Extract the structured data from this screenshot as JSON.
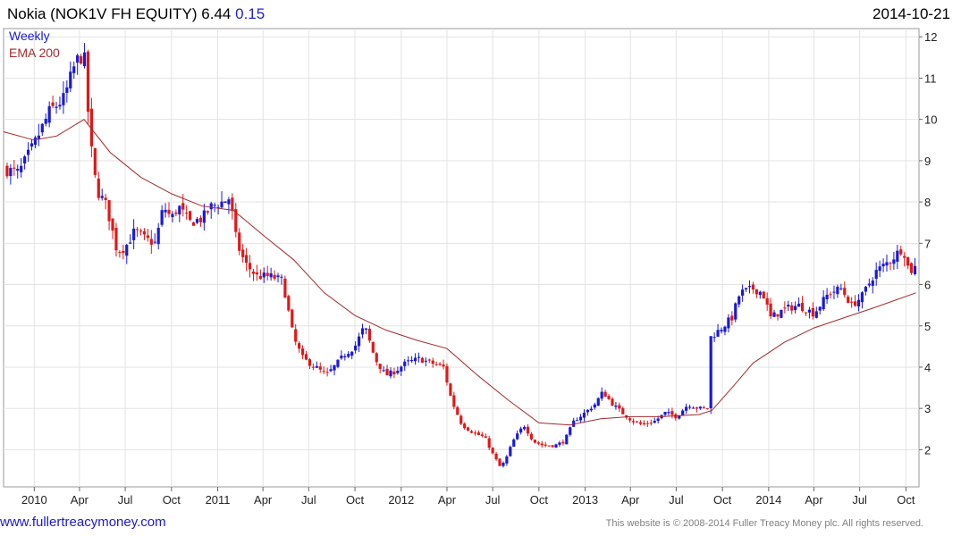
{
  "header": {
    "title": "Nokia (NOK1V FH EQUITY)",
    "price": "6.44",
    "change": "0.15",
    "date": "2014-10-21"
  },
  "footer": {
    "website": "www.fullertreacymoney.com",
    "copyright": "This website is © 2008-2014 Fuller Treacy Money plc. All rights reserved."
  },
  "colors": {
    "up": "#1a1ad6",
    "down": "#e01818",
    "ema": "#a52a2a",
    "grid": "#e3e3e3"
  },
  "chart_data": {
    "type": "candlestick",
    "frequency": "Weekly",
    "legend": [
      "Weekly",
      "EMA 200"
    ],
    "legend_placement": "top-left",
    "ylim": [
      1.1,
      12.2
    ],
    "y_ticks": [
      2,
      3,
      4,
      5,
      6,
      7,
      8,
      9,
      10,
      11,
      12
    ],
    "x_range": [
      "2009-11-01",
      "2014-10-27"
    ],
    "x_ticks": [
      {
        "label": "2010",
        "date": "2010-01-01"
      },
      {
        "label": "Apr",
        "date": "2010-04-01"
      },
      {
        "label": "Jul",
        "date": "2010-07-01"
      },
      {
        "label": "Oct",
        "date": "2010-10-01"
      },
      {
        "label": "2011",
        "date": "2011-01-01"
      },
      {
        "label": "Apr",
        "date": "2011-04-01"
      },
      {
        "label": "Jul",
        "date": "2011-07-01"
      },
      {
        "label": "Oct",
        "date": "2011-10-01"
      },
      {
        "label": "2012",
        "date": "2012-01-01"
      },
      {
        "label": "Apr",
        "date": "2012-04-01"
      },
      {
        "label": "Jul",
        "date": "2012-07-01"
      },
      {
        "label": "Oct",
        "date": "2012-10-01"
      },
      {
        "label": "2013",
        "date": "2013-01-01"
      },
      {
        "label": "Apr",
        "date": "2013-04-01"
      },
      {
        "label": "Jul",
        "date": "2013-07-01"
      },
      {
        "label": "Oct",
        "date": "2013-10-01"
      },
      {
        "label": "2014",
        "date": "2014-01-01"
      },
      {
        "label": "Apr",
        "date": "2014-04-01"
      },
      {
        "label": "Jul",
        "date": "2014-07-01"
      },
      {
        "label": "Oct",
        "date": "2014-10-01"
      }
    ],
    "price_path": [
      [
        "2009-11-01",
        8.8
      ],
      [
        "2009-12-01",
        8.7
      ],
      [
        "2010-01-01",
        9.4
      ],
      [
        "2010-02-01",
        10.2
      ],
      [
        "2010-03-01",
        10.5
      ],
      [
        "2010-03-25",
        11.4
      ],
      [
        "2010-04-10",
        11.6
      ],
      [
        "2010-04-22",
        9.5
      ],
      [
        "2010-05-05",
        8.3
      ],
      [
        "2010-05-25",
        7.9
      ],
      [
        "2010-06-15",
        6.8
      ],
      [
        "2010-07-01",
        6.9
      ],
      [
        "2010-07-20",
        7.3
      ],
      [
        "2010-08-10",
        7.1
      ],
      [
        "2010-08-30",
        7.0
      ],
      [
        "2010-09-15",
        7.9
      ],
      [
        "2010-10-01",
        7.6
      ],
      [
        "2010-10-15",
        7.9
      ],
      [
        "2010-11-05",
        7.5
      ],
      [
        "2010-12-01",
        7.6
      ],
      [
        "2010-12-20",
        7.9
      ],
      [
        "2011-01-10",
        8.0
      ],
      [
        "2011-01-25",
        8.1
      ],
      [
        "2011-02-08",
        7.0
      ],
      [
        "2011-02-25",
        6.5
      ],
      [
        "2011-03-20",
        6.2
      ],
      [
        "2011-04-15",
        6.2
      ],
      [
        "2011-05-10",
        6.1
      ],
      [
        "2011-06-01",
        4.7
      ],
      [
        "2011-06-20",
        4.2
      ],
      [
        "2011-07-15",
        4.0
      ],
      [
        "2011-08-05",
        3.8
      ],
      [
        "2011-08-20",
        4.0
      ],
      [
        "2011-09-10",
        4.3
      ],
      [
        "2011-10-01",
        4.5
      ],
      [
        "2011-10-20",
        5.0
      ],
      [
        "2011-11-10",
        4.2
      ],
      [
        "2011-12-01",
        3.8
      ],
      [
        "2011-12-20",
        3.9
      ],
      [
        "2012-01-10",
        4.1
      ],
      [
        "2012-02-05",
        4.2
      ],
      [
        "2012-03-01",
        4.1
      ],
      [
        "2012-03-25",
        4.0
      ],
      [
        "2012-04-10",
        3.2
      ],
      [
        "2012-05-01",
        2.6
      ],
      [
        "2012-05-25",
        2.4
      ],
      [
        "2012-06-15",
        2.3
      ],
      [
        "2012-07-01",
        1.9
      ],
      [
        "2012-07-15",
        1.6
      ],
      [
        "2012-07-25",
        1.7
      ],
      [
        "2012-08-10",
        2.2
      ],
      [
        "2012-09-01",
        2.6
      ],
      [
        "2012-09-20",
        2.2
      ],
      [
        "2012-10-10",
        2.1
      ],
      [
        "2012-11-01",
        2.1
      ],
      [
        "2012-11-20",
        2.2
      ],
      [
        "2012-12-10",
        2.7
      ],
      [
        "2013-01-01",
        2.9
      ],
      [
        "2013-01-20",
        3.1
      ],
      [
        "2013-02-05",
        3.4
      ],
      [
        "2013-02-25",
        3.1
      ],
      [
        "2013-03-15",
        2.9
      ],
      [
        "2013-04-05",
        2.7
      ],
      [
        "2013-04-25",
        2.6
      ],
      [
        "2013-05-20",
        2.7
      ],
      [
        "2013-06-10",
        2.9
      ],
      [
        "2013-07-01",
        2.8
      ],
      [
        "2013-07-25",
        3.1
      ],
      [
        "2013-08-15",
        3.0
      ],
      [
        "2013-09-02",
        3.0
      ],
      [
        "2013-09-05",
        4.7
      ],
      [
        "2013-09-25",
        4.9
      ],
      [
        "2013-10-20",
        5.2
      ],
      [
        "2013-11-05",
        5.8
      ],
      [
        "2013-12-01",
        5.9
      ],
      [
        "2013-12-20",
        5.8
      ],
      [
        "2014-01-05",
        5.2
      ],
      [
        "2014-02-01",
        5.4
      ],
      [
        "2014-03-01",
        5.5
      ],
      [
        "2014-04-01",
        5.3
      ],
      [
        "2014-05-01",
        5.8
      ],
      [
        "2014-05-25",
        5.9
      ],
      [
        "2014-06-15",
        5.5
      ],
      [
        "2014-07-05",
        5.7
      ],
      [
        "2014-08-01",
        6.3
      ],
      [
        "2014-09-01",
        6.6
      ],
      [
        "2014-09-25",
        6.9
      ],
      [
        "2014-10-08",
        6.3
      ],
      [
        "2014-10-21",
        6.44
      ]
    ],
    "ema_200": [
      [
        "2009-11-01",
        9.7
      ],
      [
        "2010-01-01",
        9.5
      ],
      [
        "2010-02-15",
        9.6
      ],
      [
        "2010-04-10",
        10.0
      ],
      [
        "2010-06-01",
        9.2
      ],
      [
        "2010-08-01",
        8.6
      ],
      [
        "2010-10-01",
        8.2
      ],
      [
        "2010-12-01",
        7.9
      ],
      [
        "2011-02-01",
        7.8
      ],
      [
        "2011-04-01",
        7.2
      ],
      [
        "2011-06-01",
        6.6
      ],
      [
        "2011-08-01",
        5.8
      ],
      [
        "2011-10-01",
        5.25
      ],
      [
        "2011-12-01",
        4.9
      ],
      [
        "2012-02-01",
        4.65
      ],
      [
        "2012-04-01",
        4.45
      ],
      [
        "2012-06-01",
        3.8
      ],
      [
        "2012-08-01",
        3.2
      ],
      [
        "2012-10-01",
        2.65
      ],
      [
        "2012-12-01",
        2.6
      ],
      [
        "2013-02-01",
        2.75
      ],
      [
        "2013-04-01",
        2.8
      ],
      [
        "2013-06-01",
        2.8
      ],
      [
        "2013-08-15",
        2.85
      ],
      [
        "2013-09-10",
        2.95
      ],
      [
        "2013-10-20",
        3.5
      ],
      [
        "2013-12-01",
        4.1
      ],
      [
        "2014-02-01",
        4.6
      ],
      [
        "2014-04-01",
        4.95
      ],
      [
        "2014-06-01",
        5.2
      ],
      [
        "2014-08-01",
        5.45
      ],
      [
        "2014-10-21",
        5.8
      ]
    ]
  }
}
